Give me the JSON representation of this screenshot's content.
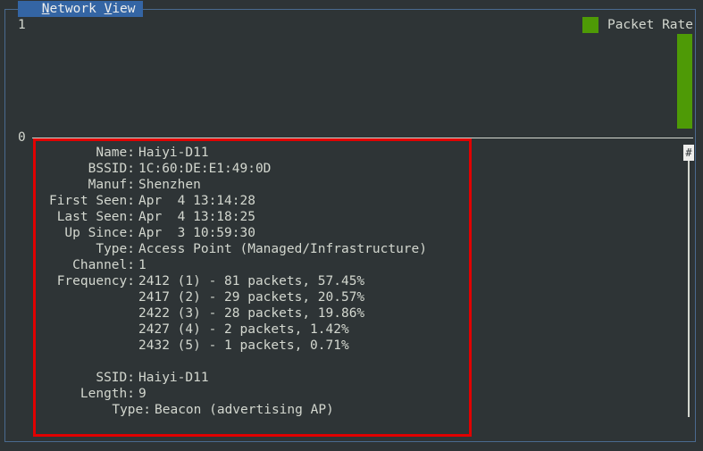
{
  "window": {
    "title_parts": [
      " ",
      "N",
      "etwork ",
      "V",
      "iew"
    ]
  },
  "chart": {
    "y_max_label": "1",
    "y_min_label": "0",
    "legend_label": "Packet Rate",
    "series_color": "#4e9a06"
  },
  "chart_data": {
    "type": "bar",
    "series": [
      {
        "name": "Packet Rate",
        "values": [
          1
        ]
      }
    ],
    "ylim": [
      0,
      1
    ]
  },
  "scrollbar": {
    "thumb_glyph": "#"
  },
  "details": {
    "name": {
      "key": "Name:",
      "value": "Haiyi-D11"
    },
    "bssid": {
      "key": "BSSID:",
      "value": "1C:60:DE:E1:49:0D"
    },
    "manuf": {
      "key": "Manuf:",
      "value": "Shenzhen"
    },
    "first_seen": {
      "key": "First Seen:",
      "value": "Apr  4 13:14:28"
    },
    "last_seen": {
      "key": "Last Seen:",
      "value": "Apr  4 13:18:25"
    },
    "up_since": {
      "key": "Up Since:",
      "value": "Apr  3 10:59:30"
    },
    "type": {
      "key": "Type:",
      "value": "Access Point (Managed/Infrastructure)"
    },
    "channel": {
      "key": "Channel:",
      "value": "1"
    },
    "frequency": {
      "key": "Frequency:",
      "values": [
        "2412 (1) - 81 packets, 57.45%",
        "2417 (2) - 29 packets, 20.57%",
        "2422 (3) - 28 packets, 19.86%",
        "2427 (4) - 2 packets, 1.42%",
        "2432 (5) - 1 packets, 0.71%"
      ]
    },
    "ssid": {
      "key": "SSID:",
      "value": "Haiyi-D11"
    },
    "length": {
      "key": "Length:",
      "value": "9"
    },
    "ssid_type": {
      "key": "Type:",
      "value": "Beacon (advertising AP)"
    }
  }
}
